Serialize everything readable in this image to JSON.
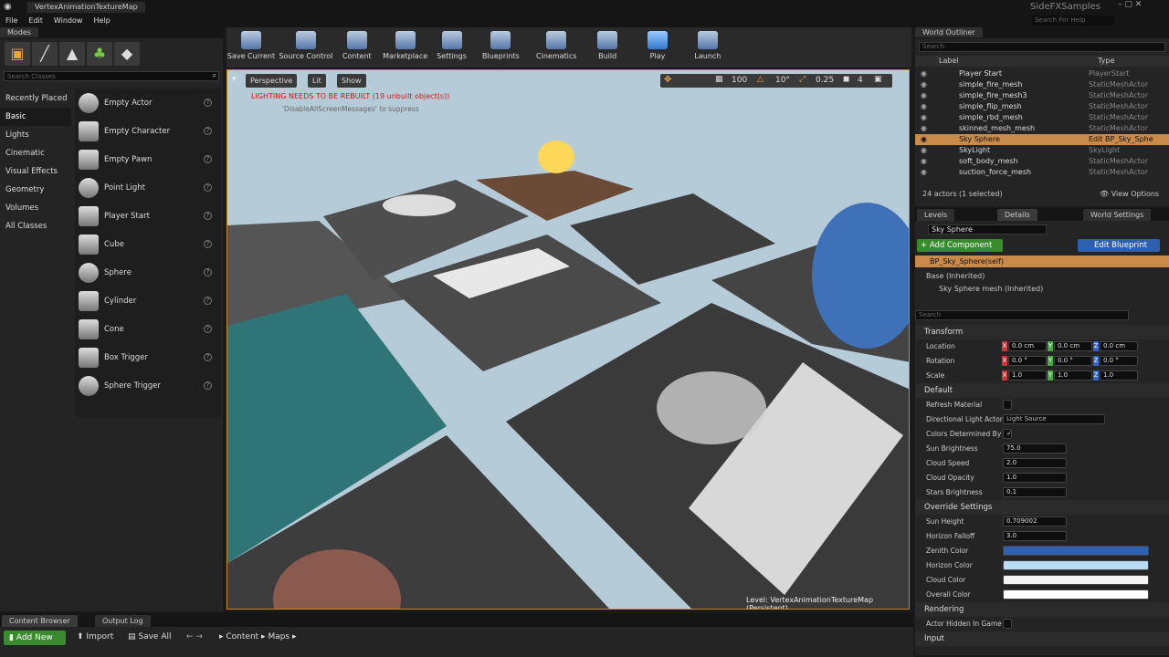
{
  "title": {
    "window": "VertexAnimationTextureMap",
    "app": "SideFXSamples",
    "search_help": "Search For Help"
  },
  "menu": [
    "File",
    "Edit",
    "Window",
    "Help"
  ],
  "modes": {
    "tab": "Modes",
    "search_placeholder": "Search Classes",
    "categories": [
      "Recently Placed",
      "Basic",
      "Lights",
      "Cinematic",
      "Visual Effects",
      "Geometry",
      "Volumes",
      "All Classes"
    ],
    "items": [
      "Empty Actor",
      "Empty Character",
      "Empty Pawn",
      "Point Light",
      "Player Start",
      "Cube",
      "Sphere",
      "Cylinder",
      "Cone",
      "Box Trigger",
      "Sphere Trigger"
    ]
  },
  "toolbar": [
    "Save Current",
    "Source Control",
    "Content",
    "Marketplace",
    "Settings",
    "Blueprints",
    "Cinematics",
    "Build",
    "Play",
    "Launch"
  ],
  "viewport": {
    "perspective": "Perspective",
    "lit": "Lit",
    "show": "Show",
    "warning": "LIGHTING NEEDS TO BE REBUILT (19 unbuilt object(s))",
    "suppress": "'DisableAllScreenMessages' to suppress",
    "grid": "100",
    "angle": "10°",
    "scale": "0.25",
    "cam": "4",
    "level_label": "Level:",
    "level_name": "VertexAnimationTextureMap (Persistent)"
  },
  "outliner": {
    "tab": "World Outliner",
    "search_placeholder": "Search",
    "col_label": "Label",
    "col_type": "Type",
    "rows": [
      {
        "label": "Player Start",
        "type": "PlayerStart"
      },
      {
        "label": "simple_fire_mesh",
        "type": "StaticMeshActor"
      },
      {
        "label": "simple_fire_mesh3",
        "type": "StaticMeshActor"
      },
      {
        "label": "simple_flip_mesh",
        "type": "StaticMeshActor"
      },
      {
        "label": "simple_rbd_mesh",
        "type": "StaticMeshActor"
      },
      {
        "label": "skinned_mesh_mesh",
        "type": "StaticMeshActor"
      },
      {
        "label": "Sky Sphere",
        "type": "Edit BP_Sky_Sphe"
      },
      {
        "label": "SkyLight",
        "type": "SkyLight"
      },
      {
        "label": "soft_body_mesh",
        "type": "StaticMeshActor"
      },
      {
        "label": "suction_force_mesh",
        "type": "StaticMeshActor"
      }
    ],
    "count": "24 actors (1 selected)",
    "view_options": "View Options"
  },
  "details": {
    "tabs": [
      "Levels",
      "Details",
      "World Settings"
    ],
    "name": "Sky Sphere",
    "add_component": "+ Add Component",
    "edit_blueprint": "Edit Blueprint",
    "self": "BP_Sky_Sphere(self)",
    "base": "Base (Inherited)",
    "mesh": "Sky Sphere mesh (Inherited)",
    "search_placeholder": "Search",
    "transform": "Transform",
    "location": "Location",
    "rotation": "Rotation",
    "scale": "Scale",
    "loc": [
      "0.0 cm",
      "0.0 cm",
      "0.0 cm"
    ],
    "rot": [
      "0.0 °",
      "0.0 °",
      "0.0 °"
    ],
    "scl": [
      "1.0",
      "1.0",
      "1.0"
    ],
    "default": "Default",
    "refresh": "Refresh Material",
    "dir_light": "Directional Light Actor",
    "light_source": "Light Source",
    "colors_det": "Colors Determined By Su",
    "sun_brightness": "Sun Brightness",
    "sun_val": "75.0",
    "cloud_speed": "Cloud Speed",
    "cloud_speed_val": "2.0",
    "cloud_opacity": "Cloud Opacity",
    "cloud_opacity_val": "1.0",
    "stars": "Stars Brightness",
    "stars_val": "0.1",
    "override": "Override Settings",
    "sun_height": "Sun Height",
    "sun_height_val": "0.709002",
    "horizon_falloff": "Horizon Falloff",
    "horizon_val": "3.0",
    "zenith": "Zenith Color",
    "horizon_color": "Horizon Color",
    "cloud_color": "Cloud Color",
    "overall": "Overall Color",
    "rendering": "Rendering",
    "hidden": "Actor Hidden In Game",
    "input": "Input"
  },
  "bottom": {
    "tab1": "Content Browser",
    "tab2": "Output Log",
    "add_new": "Add New",
    "import": "Import",
    "save_all": "Save All",
    "crumbs": [
      "Content",
      "Maps"
    ]
  }
}
